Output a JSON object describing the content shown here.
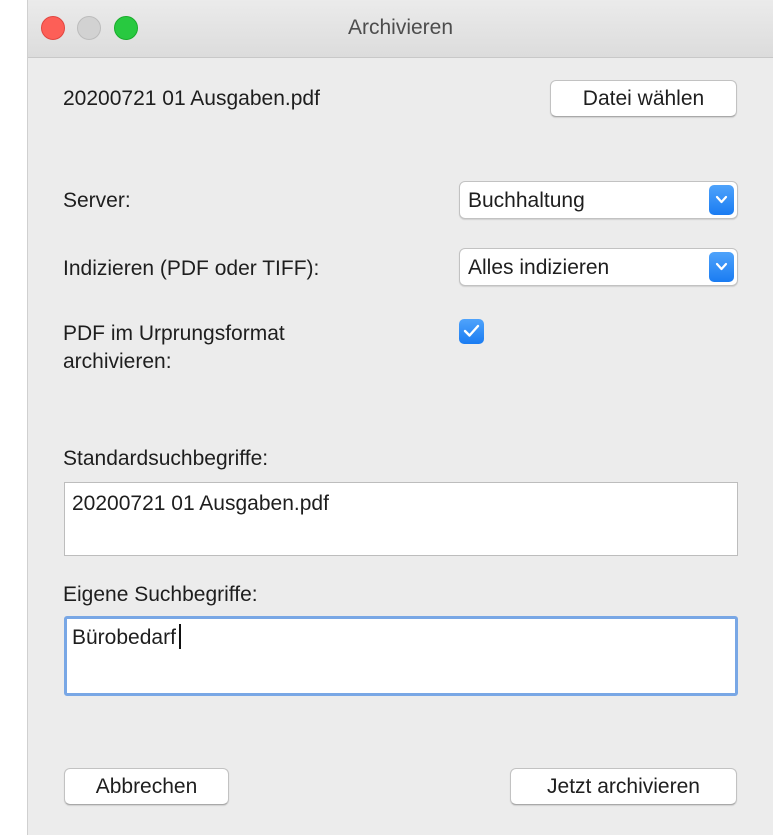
{
  "window": {
    "title": "Archivieren"
  },
  "file": {
    "name": "20200721 01 Ausgaben.pdf",
    "choose_button": "Datei wählen"
  },
  "server": {
    "label": "Server:",
    "value": "Buchhaltung"
  },
  "index": {
    "label": "Indizieren (PDF oder TIFF):",
    "value": "Alles indizieren"
  },
  "archive_original": {
    "label_line1": "PDF im Urprungsformat",
    "label_line2": "archivieren:",
    "checked": true
  },
  "standard_terms": {
    "label": "Standardsuchbegriffe:",
    "value": "20200721 01 Ausgaben.pdf"
  },
  "custom_terms": {
    "label": "Eigene Suchbegriffe:",
    "value": "Bürobedarf"
  },
  "buttons": {
    "cancel": "Abbrechen",
    "archive_now": "Jetzt archivieren"
  },
  "colors": {
    "accent": "#1a7cf2",
    "close": "#fd5f57",
    "maximize": "#28c940",
    "focus_ring": "#79a7e5"
  }
}
